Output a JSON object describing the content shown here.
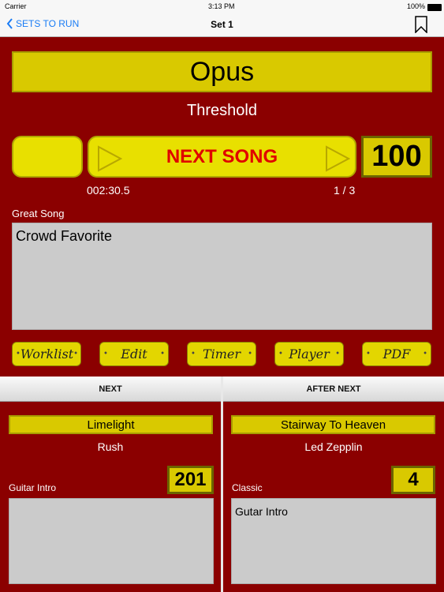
{
  "status": {
    "carrier": "Carrier",
    "time": "3:13 PM",
    "battery": "100%"
  },
  "nav": {
    "back_label": "SETS TO RUN",
    "title": "Set 1"
  },
  "current": {
    "title": "Opus",
    "artist": "Threshold",
    "next_label": "NEXT SONG",
    "counter": "100",
    "timer": "002:30.5",
    "position": "1 / 3",
    "note_label": "Great Song",
    "note_text": "Crowd Favorite"
  },
  "buttons": [
    {
      "label": "Worklist"
    },
    {
      "label": "Edit"
    },
    {
      "label": "Timer"
    },
    {
      "label": "Player"
    },
    {
      "label": "PDF"
    }
  ],
  "next": {
    "header": "NEXT",
    "title": "Limelight",
    "artist": "Rush",
    "counter": "201",
    "note_label": "Guitar Intro",
    "note_text": ""
  },
  "after_next": {
    "header": "AFTER NEXT",
    "title": "Stairway To Heaven",
    "artist": "Led Zepplin",
    "counter": "4",
    "note_label": "Classic",
    "note_text": "Gutar Intro"
  },
  "colors": {
    "background": "#8b0000",
    "accent": "#d9c900",
    "next_text": "#e00000",
    "link": "#1a7cf5"
  }
}
